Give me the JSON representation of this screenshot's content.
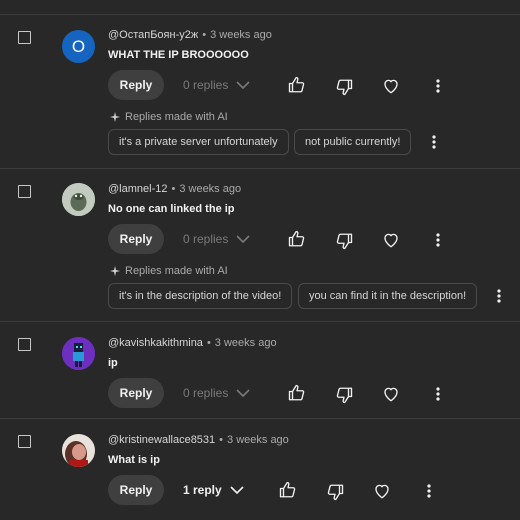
{
  "colors": {
    "background": "#282828",
    "button_bg": "#3f3f3f",
    "divider": "#3d3d3d",
    "muted_text": "#aaaaaa",
    "avatar_blue": "#1565c0"
  },
  "comments": [
    {
      "author": "@ОстапБоян-у2ж",
      "age": "3 weeks ago",
      "text": "WHAT THE IP BROOOOOO",
      "avatar_letter": "О",
      "reply_label": "Reply",
      "replies_label": "0 replies",
      "ai_label": "Replies made with AI",
      "suggestions": [
        "it's a private server unfortunately",
        "not public currently!"
      ]
    },
    {
      "author": "@lamnel-12",
      "age": "3 weeks ago",
      "text": "No one can linked the ip",
      "reply_label": "Reply",
      "replies_label": "0 replies",
      "ai_label": "Replies made with AI",
      "suggestions": [
        "it's in the description of the video!",
        "you can find it in the description!"
      ]
    },
    {
      "author": "@kavishkakithmina",
      "age": "3 weeks ago",
      "text": "ip",
      "reply_label": "Reply",
      "replies_label": "0 replies"
    },
    {
      "author": "@kristinewallace8531",
      "age": "3 weeks ago",
      "text": "What is ip",
      "reply_label": "Reply",
      "replies_label": "1 reply"
    }
  ],
  "icons": {
    "like": "thumbs-up-icon",
    "dislike": "thumbs-down-icon",
    "heart": "heart-icon",
    "more": "more-vert-icon",
    "sparkle": "sparkle-icon",
    "chevron": "chevron-down-icon"
  }
}
